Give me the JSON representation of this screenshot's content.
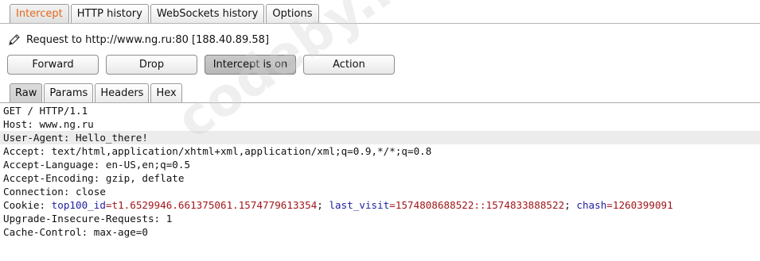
{
  "top_tabs": [
    {
      "label": "Intercept",
      "active": true
    },
    {
      "label": "HTTP history",
      "active": false
    },
    {
      "label": "WebSockets history",
      "active": false
    },
    {
      "label": "Options",
      "active": false
    }
  ],
  "request": {
    "icon": "pencil-icon",
    "text": "Request to http://www.ng.ru:80  [188.40.89.58]"
  },
  "buttons": {
    "forward": "Forward",
    "drop": "Drop",
    "intercept": "Intercept is on",
    "action": "Action"
  },
  "sub_tabs": [
    {
      "label": "Raw",
      "active": true
    },
    {
      "label": "Params",
      "active": false
    },
    {
      "label": "Headers",
      "active": false
    },
    {
      "label": "Hex",
      "active": false
    }
  ],
  "editor_lines": [
    "GET / HTTP/1.1",
    "Host: www.ng.ru",
    "User-Agent: Hello_there!",
    "Accept: text/html,application/xhtml+xml,application/xml;q=0.9,*/*;q=0.8",
    "Accept-Language: en-US,en;q=0.5",
    "Accept-Encoding: gzip, deflate",
    "Connection: close"
  ],
  "cookie": {
    "prefix": "Cookie: ",
    "k1": "top100_id",
    "v1": "=t1.6529946.661375061.1574779613354",
    "sep1": "; ",
    "k2": "last_visit",
    "v2": "=1574808688522::1574833888522",
    "sep2": "; ",
    "k3": "chash",
    "v3": "=1260399091"
  },
  "editor_lines_after": [
    "Upgrade-Insecure-Requests: 1",
    "Cache-Control: max-age=0"
  ],
  "watermark": "codeby.net",
  "colors": {
    "active_tab_text": "#e2681c",
    "cookie_key": "#1f1fa0",
    "cookie_value": "#a0161a",
    "highlight_line": "#ececec"
  }
}
